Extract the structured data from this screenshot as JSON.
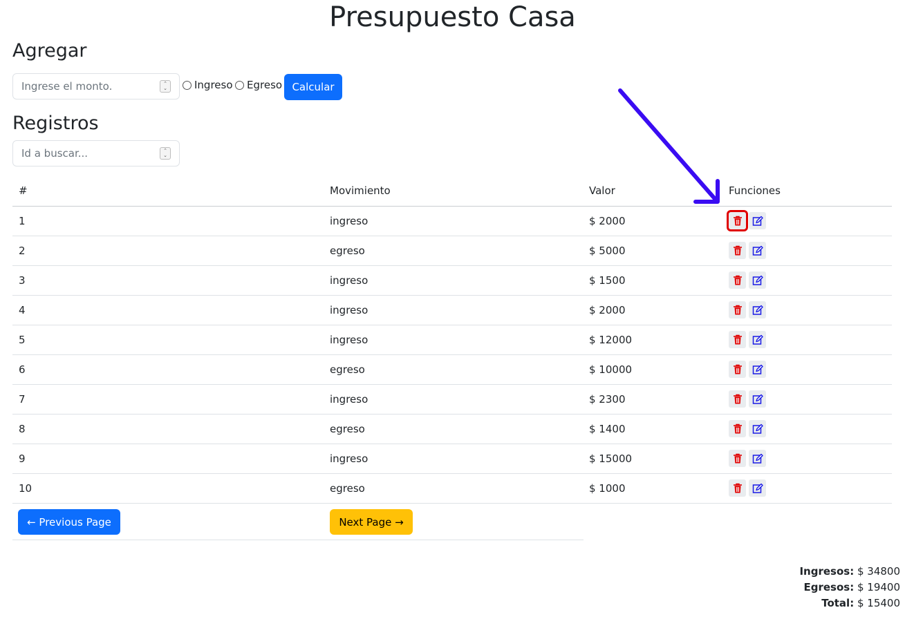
{
  "page": {
    "title": "Presupuesto Casa"
  },
  "add_section": {
    "heading": "Agregar",
    "amount_placeholder": "Ingrese el monto.",
    "radio_income": "Ingreso",
    "radio_expense": "Egreso",
    "calculate_button": "Calcular"
  },
  "records_section": {
    "heading": "Registros",
    "search_placeholder": "Id a buscar...",
    "columns": [
      "#",
      "Movimiento",
      "Valor",
      "Funciones"
    ],
    "rows": [
      {
        "id": "1",
        "movement": "ingreso",
        "value": "$ 2000"
      },
      {
        "id": "2",
        "movement": "egreso",
        "value": "$ 5000"
      },
      {
        "id": "3",
        "movement": "ingreso",
        "value": "$ 1500"
      },
      {
        "id": "4",
        "movement": "ingreso",
        "value": "$ 2000"
      },
      {
        "id": "5",
        "movement": "ingreso",
        "value": "$ 12000"
      },
      {
        "id": "6",
        "movement": "egreso",
        "value": "$ 10000"
      },
      {
        "id": "7",
        "movement": "ingreso",
        "value": "$ 2300"
      },
      {
        "id": "8",
        "movement": "egreso",
        "value": "$ 1400"
      },
      {
        "id": "9",
        "movement": "ingreso",
        "value": "$ 15000"
      },
      {
        "id": "10",
        "movement": "egreso",
        "value": "$ 1000"
      }
    ],
    "actions": {
      "delete_icon": "trash-icon",
      "edit_icon": "edit-icon"
    },
    "selected_delete_row": 1
  },
  "pagination": {
    "previous_label": "← Previous Page",
    "next_label": "Next Page →"
  },
  "totals": {
    "income_label": "Ingresos:",
    "income_value": " $ 34800",
    "expense_label": "Egresos:",
    "expense_value": " $ 19400",
    "total_label": "Total:",
    "total_value": " $ 15400"
  },
  "colors": {
    "primary": "#0d6efd",
    "warning": "#ffc107",
    "delete": "#e00000",
    "edit": "#1a1ae6",
    "annotation_arrow": "#3a0cf2",
    "highlight_box": "#e00000"
  }
}
